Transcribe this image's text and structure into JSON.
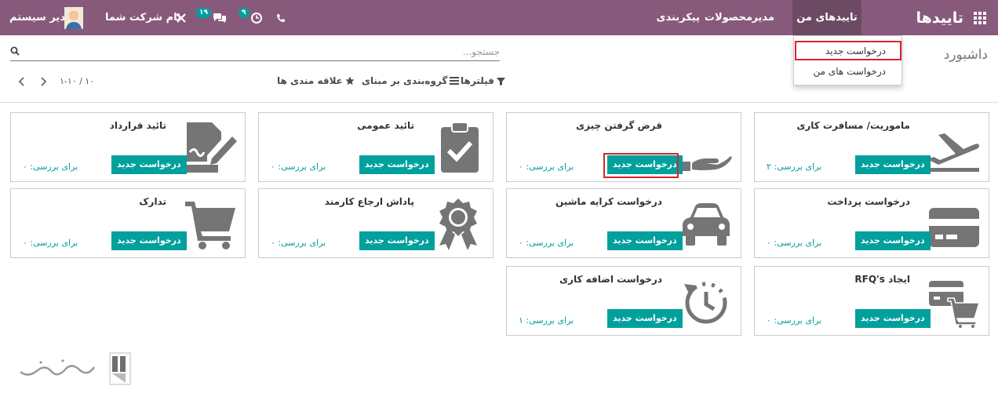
{
  "navbar": {
    "app_title": "تاییدها",
    "menus": [
      "تاییدهای من",
      "مدیر",
      "محصولات",
      "پیکربندی"
    ],
    "user_name": "مدیر سیستم",
    "company": "نام شرکت شما",
    "messages_count": "۱۹",
    "activities_count": "۹"
  },
  "dropdown": {
    "items": [
      "درخواست جدید",
      "درخواست های من"
    ]
  },
  "control": {
    "breadcrumb": "داشبورد",
    "search_placeholder": "جستجو...",
    "filters_label": "فیلترها",
    "groupby_label": "گروه‌بندی بر مبنای",
    "favorites_label": "علاقه مندی ها",
    "pager_value": "۱-۱۰ / ۱۰"
  },
  "cards": [
    {
      "title": "ماموریت/ مسافرت کاری",
      "button": "درخواست جدید",
      "count": "برای بررسی: ۲",
      "icon": "plane-icon"
    },
    {
      "title": "قرض گرفتن چیزی",
      "button": "درخواست جدید",
      "count": "برای بررسی: ۰",
      "icon": "hand-icon"
    },
    {
      "title": "تائید عمومی",
      "button": "درخواست جدید",
      "count": "برای بررسی: ۰",
      "icon": "clipboard-check-icon"
    },
    {
      "title": "تائید قرارداد",
      "button": "درخواست جدید",
      "count": "برای بررسی: ۰",
      "icon": "contract-sign-icon"
    },
    {
      "title": "درخواست پرداخت",
      "button": "درخواست جدید",
      "count": "برای بررسی: ۰",
      "icon": "credit-card-icon"
    },
    {
      "title": "درخواست کرایه ماشین",
      "button": "درخواست جدید",
      "count": "برای بررسی: ۰",
      "icon": "car-icon"
    },
    {
      "title": "پاداش ارجاع کارمند",
      "button": "درخواست جدید",
      "count": "برای بررسی: ۰",
      "icon": "award-icon"
    },
    {
      "title": "تدارک",
      "button": "درخواست جدید",
      "count": "برای بررسی: ۰",
      "icon": "cart-icon"
    },
    {
      "title": "ایجاد RFQ's",
      "button": "درخواست جدید",
      "count": "برای بررسی: ۰",
      "icon": "card-cart-icon"
    },
    {
      "title": "درخواست اضافه کاری",
      "button": "درخواست جدید",
      "count": "برای بررسی: ۱",
      "icon": "clock-history-icon"
    }
  ],
  "colors": {
    "navbar": "#875a7b",
    "accent": "#00a09d",
    "highlight": "#d9262b"
  }
}
